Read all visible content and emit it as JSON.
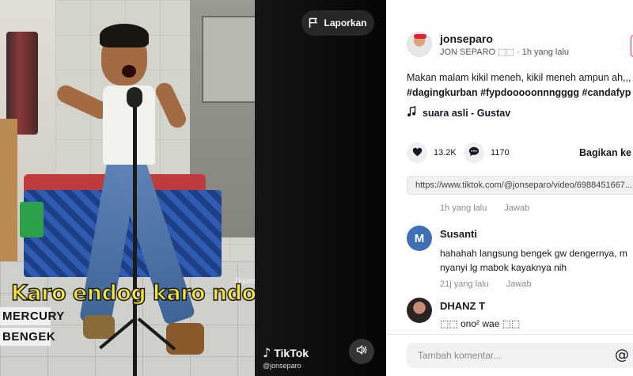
{
  "video": {
    "caption": "Karo endog karo ndog",
    "badges": [
      "MERCURY",
      "BENGEK"
    ],
    "report_label": "Laporkan",
    "watermark_brand": "TikTok",
    "watermark_user": "@jonseparo",
    "overlay_handle": "@jonseparo"
  },
  "post": {
    "username": "jonseparo",
    "display_name_line": "JON SEPARO ⬚⬚ · 1h yang lalu",
    "description": "Makan malam kikil meneh, kikil meneh ampun ah,,,",
    "hashtags": "#dagingkurban #fypdooooonnngggg #candafyp",
    "sound": "suara asli - Gustav",
    "likes": "13.2K",
    "comments_count": "1170",
    "share_label": "Bagikan ke",
    "link": "https://www.tiktok.com/@jonseparo/video/6988451667..."
  },
  "comments": {
    "top_meta": {
      "time": "1h yang lalu",
      "reply": "Jawab"
    },
    "items": [
      {
        "initial": "M",
        "avatar_color": "#3f6fb5",
        "name": "Susanti",
        "text_line1": "hahahah langsung bengek gw dengernya, m",
        "text_line2": "nyanyi lg mabok kayaknya nih",
        "time": "21j yang lalu",
        "reply": "Jawab"
      },
      {
        "initial": "",
        "avatar_color": "#2b2222",
        "name": "DHANZ T",
        "text_line1": "⬚⬚ ono² wae ⬚⬚"
      }
    ]
  },
  "input": {
    "placeholder": "Tambah komentar..."
  },
  "icons": {
    "report": "flag-icon",
    "sound": "music-note-icon",
    "like": "heart-icon",
    "comment": "chat-bubble-icon",
    "volume": "speaker-icon",
    "mention": "at-sign-icon"
  }
}
